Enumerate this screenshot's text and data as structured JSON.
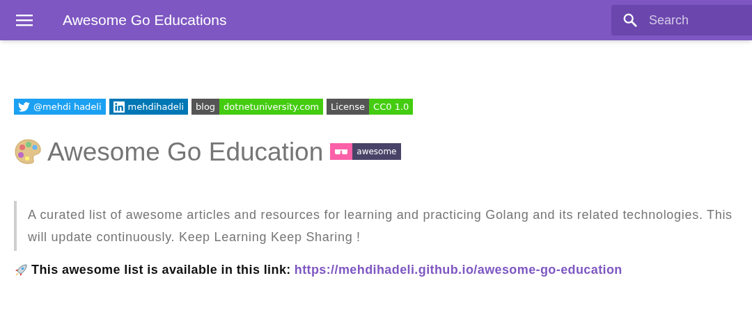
{
  "header": {
    "title": "Awesome Go Educations",
    "search": {
      "placeholder": "Search"
    }
  },
  "badges": [
    {
      "kind": "twitter",
      "label": "@mehdi hadeli",
      "color": "#1ca0f2"
    },
    {
      "kind": "linkedin",
      "label": "mehdihadeli",
      "color": "#0077b5"
    },
    {
      "kind": "pair",
      "label": "blog",
      "value": "dotnetuniversity.com",
      "color": "#4c1"
    },
    {
      "kind": "pair",
      "label": "License",
      "value": "CC0 1.0",
      "color": "#4c1"
    }
  ],
  "heading": {
    "text": "Awesome Go Education",
    "badge": "awesome"
  },
  "quote": {
    "lines": [
      "A curated list of awesome articles and resources for learning and practicing Golang and its related technologies. This",
      "will update continuously. Keep Learning Keep Sharing !"
    ]
  },
  "link_line": {
    "text": "This awesome list is available in this link:",
    "link": "https://mehdihadeli.github.io/awesome-go-education"
  }
}
